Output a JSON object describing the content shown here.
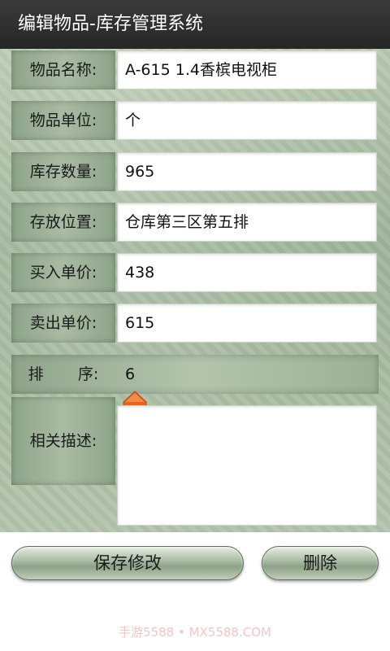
{
  "app": {
    "title": "编辑物品-库存管理系统"
  },
  "form": {
    "fields": [
      {
        "label": "物品名称:",
        "value": "A-615 1.4香槟电视柜"
      },
      {
        "label": "物品单位:",
        "value": "个"
      },
      {
        "label": "库存数量:",
        "value": "965"
      },
      {
        "label": "存放位置:",
        "value": "仓库第三区第五排"
      },
      {
        "label": "买入单价:",
        "value": "438"
      },
      {
        "label": "卖出单价:",
        "value": "615"
      }
    ],
    "sort": {
      "label": "排       序:",
      "value": "6"
    },
    "description": {
      "label": "相关描述:",
      "value": ""
    }
  },
  "buttons": {
    "save": "保存修改",
    "delete": "删除"
  },
  "watermark": "手游5588 • MX5588.COM",
  "colors": {
    "cursor": "#e8641c",
    "titlebar": "#2e2e2e",
    "panel": "#a9bca3"
  }
}
